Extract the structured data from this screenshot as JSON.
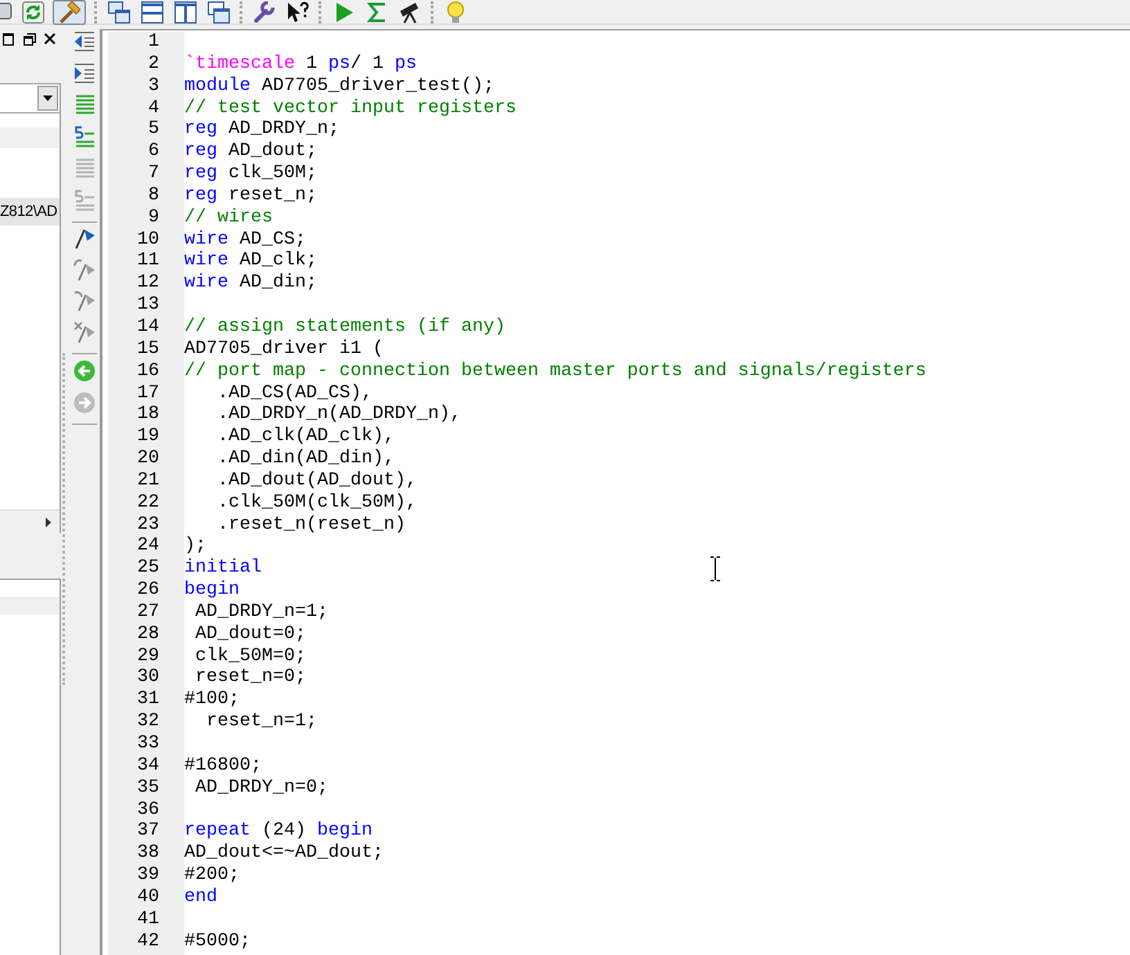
{
  "toolbar": [
    {
      "kind": "clipped"
    },
    {
      "kind": "refresh",
      "pressed": false
    },
    {
      "kind": "compile",
      "pressed": true
    },
    {
      "kind": "separator"
    },
    {
      "kind": "cascade",
      "pressed": false
    },
    {
      "kind": "split-horizontal",
      "pressed": false
    },
    {
      "kind": "split-vertical",
      "pressed": false
    },
    {
      "kind": "tile",
      "pressed": false
    },
    {
      "kind": "separator"
    },
    {
      "kind": "settings",
      "pressed": false
    },
    {
      "kind": "help",
      "pressed": false
    },
    {
      "kind": "separator"
    },
    {
      "kind": "run",
      "pressed": false
    },
    {
      "kind": "sum",
      "pressed": false
    },
    {
      "kind": "telescope",
      "pressed": false
    },
    {
      "kind": "separator"
    },
    {
      "kind": "tip",
      "pressed": false
    }
  ],
  "project_panel": {
    "items": [
      {
        "label": "Z812\\AD",
        "selected": true
      }
    ]
  },
  "side_toolbar": [
    {
      "kind": "outdent",
      "disabled": false
    },
    {
      "kind": "indent",
      "disabled": false
    },
    {
      "kind": "lines",
      "disabled": false
    },
    {
      "kind": "numbered",
      "disabled": false
    },
    {
      "kind": "lines",
      "disabled": true
    },
    {
      "kind": "numbered",
      "disabled": true
    },
    {
      "kind": "separator"
    },
    {
      "kind": "flag",
      "disabled": false
    },
    {
      "kind": "flag-prev",
      "disabled": true
    },
    {
      "kind": "flag-next",
      "disabled": true
    },
    {
      "kind": "flag-clear",
      "disabled": true
    },
    {
      "kind": "separator"
    },
    {
      "kind": "back",
      "disabled": false
    },
    {
      "kind": "forward",
      "disabled": true
    },
    {
      "kind": "separator"
    }
  ],
  "editor": {
    "lines": [
      {
        "number": "1"
      },
      {
        "number": "2",
        "tokens": [
          {
            "kind": "directive",
            "text": "`timescale"
          },
          {
            "kind": "plain",
            "text": " 1 "
          },
          {
            "kind": "keyword",
            "text": "ps"
          },
          {
            "kind": "plain",
            "text": "/ 1 "
          },
          {
            "kind": "keyword",
            "text": "ps"
          }
        ]
      },
      {
        "number": "3",
        "tokens": [
          {
            "kind": "keyword",
            "text": "module"
          },
          {
            "kind": "plain",
            "text": " AD7705_driver_test();"
          }
        ]
      },
      {
        "number": "4",
        "tokens": [
          {
            "kind": "comment",
            "text": "// test vector input registers"
          }
        ]
      },
      {
        "number": "5",
        "tokens": [
          {
            "kind": "keyword",
            "text": "reg"
          },
          {
            "kind": "plain",
            "text": " AD_DRDY_n;"
          }
        ]
      },
      {
        "number": "6",
        "tokens": [
          {
            "kind": "keyword",
            "text": "reg"
          },
          {
            "kind": "plain",
            "text": " AD_dout;"
          }
        ]
      },
      {
        "number": "7",
        "tokens": [
          {
            "kind": "keyword",
            "text": "reg"
          },
          {
            "kind": "plain",
            "text": " clk_50M;"
          }
        ]
      },
      {
        "number": "8",
        "tokens": [
          {
            "kind": "keyword",
            "text": "reg"
          },
          {
            "kind": "plain",
            "text": " reset_n;"
          }
        ]
      },
      {
        "number": "9",
        "tokens": [
          {
            "kind": "comment",
            "text": "// wires"
          }
        ]
      },
      {
        "number": "10",
        "tokens": [
          {
            "kind": "keyword",
            "text": "wire"
          },
          {
            "kind": "plain",
            "text": " AD_CS;"
          }
        ]
      },
      {
        "number": "11",
        "tokens": [
          {
            "kind": "keyword",
            "text": "wire"
          },
          {
            "kind": "plain",
            "text": " AD_clk;"
          }
        ]
      },
      {
        "number": "12",
        "tokens": [
          {
            "kind": "keyword",
            "text": "wire"
          },
          {
            "kind": "plain",
            "text": " AD_din;"
          }
        ]
      },
      {
        "number": "13"
      },
      {
        "number": "14",
        "tokens": [
          {
            "kind": "comment",
            "text": "// assign statements (if any)"
          }
        ]
      },
      {
        "number": "15",
        "tokens": [
          {
            "kind": "plain",
            "text": "AD7705_driver i1 ("
          }
        ]
      },
      {
        "number": "16",
        "tokens": [
          {
            "kind": "comment",
            "text": "// port map - connection between master ports and signals/registers"
          }
        ]
      },
      {
        "number": "17",
        "tokens": [
          {
            "kind": "plain",
            "text": "   .AD_CS(AD_CS),"
          }
        ]
      },
      {
        "number": "18",
        "tokens": [
          {
            "kind": "plain",
            "text": "   .AD_DRDY_n(AD_DRDY_n),"
          }
        ]
      },
      {
        "number": "19",
        "tokens": [
          {
            "kind": "plain",
            "text": "   .AD_clk(AD_clk),"
          }
        ]
      },
      {
        "number": "20",
        "tokens": [
          {
            "kind": "plain",
            "text": "   .AD_din(AD_din),"
          }
        ]
      },
      {
        "number": "21",
        "tokens": [
          {
            "kind": "plain",
            "text": "   .AD_dout(AD_dout),"
          }
        ]
      },
      {
        "number": "22",
        "tokens": [
          {
            "kind": "plain",
            "text": "   .clk_50M(clk_50M),"
          }
        ]
      },
      {
        "number": "23",
        "tokens": [
          {
            "kind": "plain",
            "text": "   .reset_n(reset_n)"
          }
        ]
      },
      {
        "number": "24",
        "tokens": [
          {
            "kind": "plain",
            "text": ");"
          }
        ]
      },
      {
        "number": "25",
        "tokens": [
          {
            "kind": "keyword",
            "text": "initial"
          }
        ]
      },
      {
        "number": "26",
        "tokens": [
          {
            "kind": "keyword",
            "text": "begin"
          }
        ]
      },
      {
        "number": "27",
        "tokens": [
          {
            "kind": "plain",
            "text": " AD_DRDY_n=1;"
          }
        ]
      },
      {
        "number": "28",
        "tokens": [
          {
            "kind": "plain",
            "text": " AD_dout=0;"
          }
        ]
      },
      {
        "number": "29",
        "tokens": [
          {
            "kind": "plain",
            "text": " clk_50M=0;"
          }
        ]
      },
      {
        "number": "30",
        "tokens": [
          {
            "kind": "plain",
            "text": " reset_n=0;"
          }
        ]
      },
      {
        "number": "31",
        "tokens": [
          {
            "kind": "plain",
            "text": "#100;"
          }
        ]
      },
      {
        "number": "32",
        "tokens": [
          {
            "kind": "plain",
            "text": "  reset_n=1;"
          }
        ]
      },
      {
        "number": "33"
      },
      {
        "number": "34",
        "tokens": [
          {
            "kind": "plain",
            "text": "#16800;"
          }
        ]
      },
      {
        "number": "35",
        "tokens": [
          {
            "kind": "plain",
            "text": " AD_DRDY_n=0;"
          }
        ]
      },
      {
        "number": "36"
      },
      {
        "number": "37",
        "tokens": [
          {
            "kind": "keyword",
            "text": "repeat"
          },
          {
            "kind": "plain",
            "text": " (24) "
          },
          {
            "kind": "keyword",
            "text": "begin"
          }
        ]
      },
      {
        "number": "38",
        "tokens": [
          {
            "kind": "plain",
            "text": "AD_dout<=~AD_dout;"
          }
        ]
      },
      {
        "number": "39",
        "tokens": [
          {
            "kind": "plain",
            "text": "#200;"
          }
        ]
      },
      {
        "number": "40",
        "tokens": [
          {
            "kind": "keyword",
            "text": "end"
          }
        ]
      },
      {
        "number": "41"
      },
      {
        "number": "42",
        "tokens": [
          {
            "kind": "plain",
            "text": "#5000;"
          }
        ]
      }
    ]
  }
}
